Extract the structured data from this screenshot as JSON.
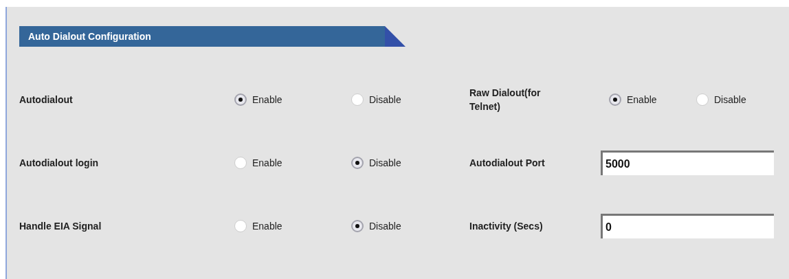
{
  "section": {
    "title": "Auto Dialout Configuration"
  },
  "rows": [
    {
      "label": "Autodialout",
      "options": [
        {
          "label": "Enable",
          "selected": true
        },
        {
          "label": "Disable",
          "selected": false
        }
      ],
      "right": {
        "label": "Raw Dialout(for Telnet)",
        "kind": "radio",
        "options": [
          {
            "label": "Enable",
            "selected": true
          },
          {
            "label": "Disable",
            "selected": false
          }
        ]
      }
    },
    {
      "label": "Autodialout login",
      "options": [
        {
          "label": "Enable",
          "selected": false
        },
        {
          "label": "Disable",
          "selected": true
        }
      ],
      "right": {
        "label": "Autodialout Port",
        "kind": "input",
        "value": "5000"
      }
    },
    {
      "label": "Handle EIA Signal",
      "options": [
        {
          "label": "Enable",
          "selected": false
        },
        {
          "label": "Disable",
          "selected": true
        }
      ],
      "right": {
        "label": "Inactivity (Secs)",
        "kind": "input",
        "value": "0"
      }
    }
  ]
}
